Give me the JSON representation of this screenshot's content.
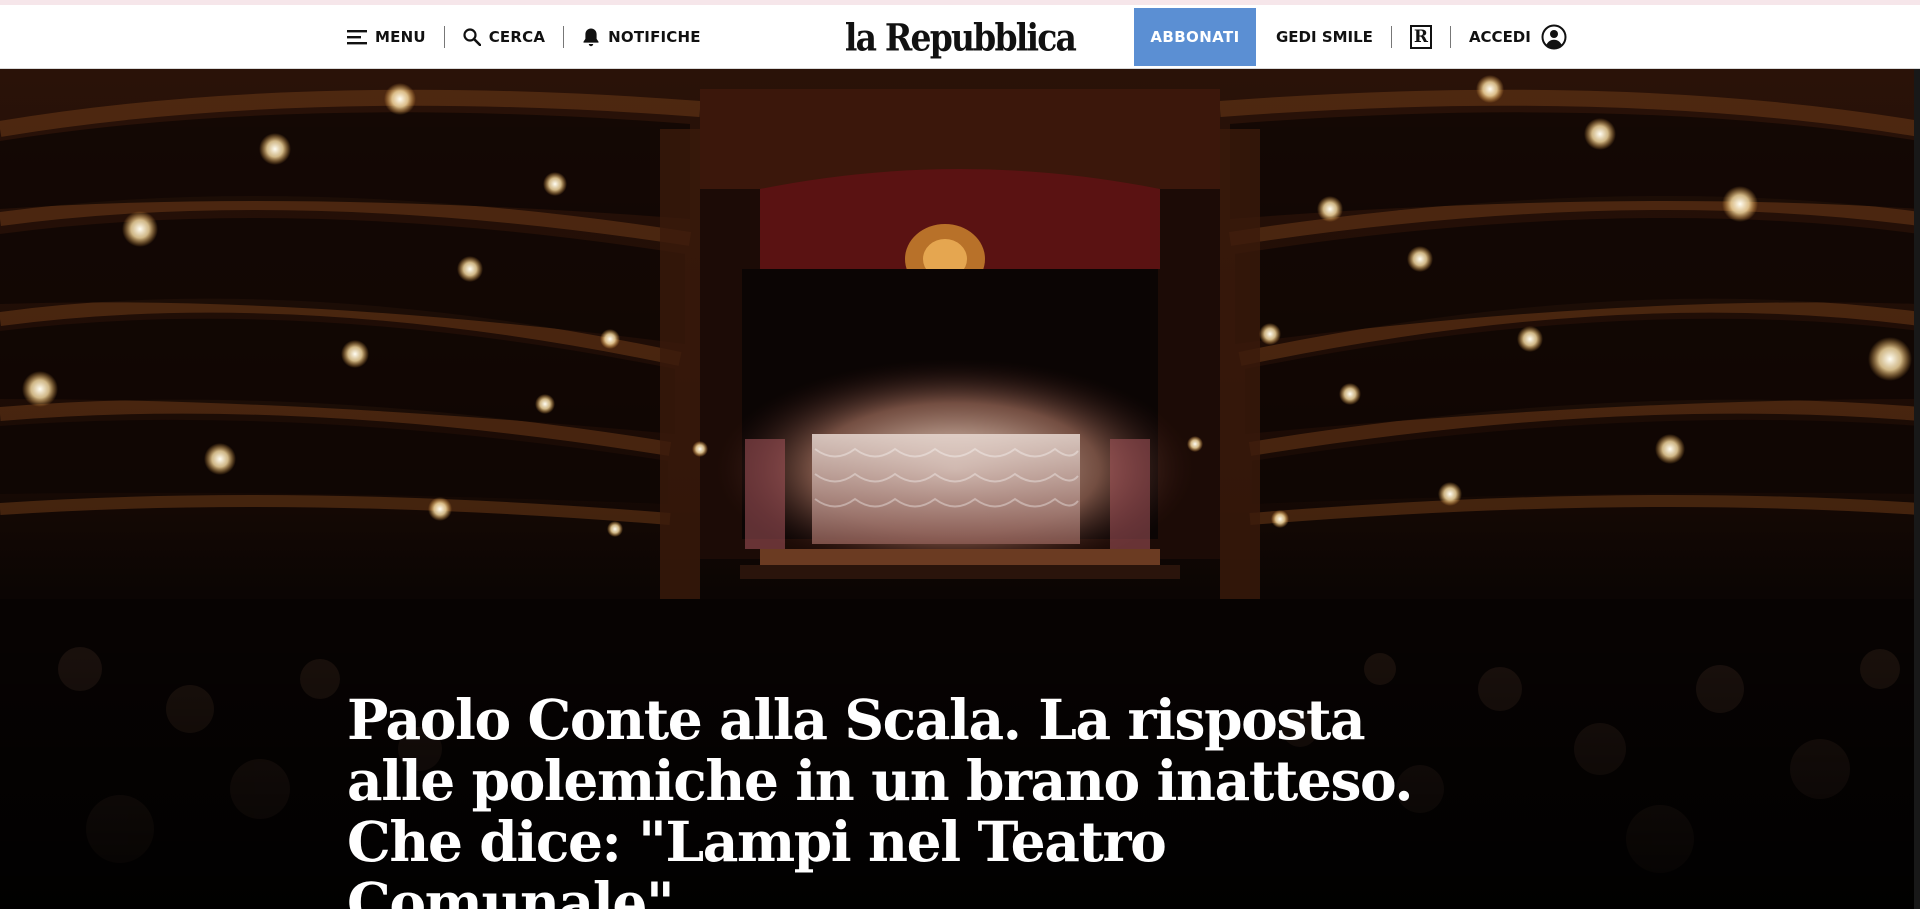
{
  "header": {
    "menu_label": "MENU",
    "search_label": "CERCA",
    "notifications_label": "NOTIFICHE",
    "logo_text": "la Repubblica",
    "subscribe_label": "ABBONATI",
    "gedi_label": "GEDI SMILE",
    "rep_badge": "R",
    "login_label": "ACCEDI",
    "colors": {
      "subscribe_bg": "#5b8fd3",
      "header_bg": "#ffffff",
      "text": "#111111"
    },
    "icons": [
      "menu-icon",
      "search-icon",
      "bell-icon",
      "user-icon"
    ]
  },
  "article": {
    "headline": "Paolo Conte alla Scala. La risposta alle polemiche in un brano inatteso. Che dice: \"Lampi nel Teatro Comunale\"",
    "hero_image_subject": "Teatro alla Scala auditorium with lit stage and crowded boxes"
  }
}
